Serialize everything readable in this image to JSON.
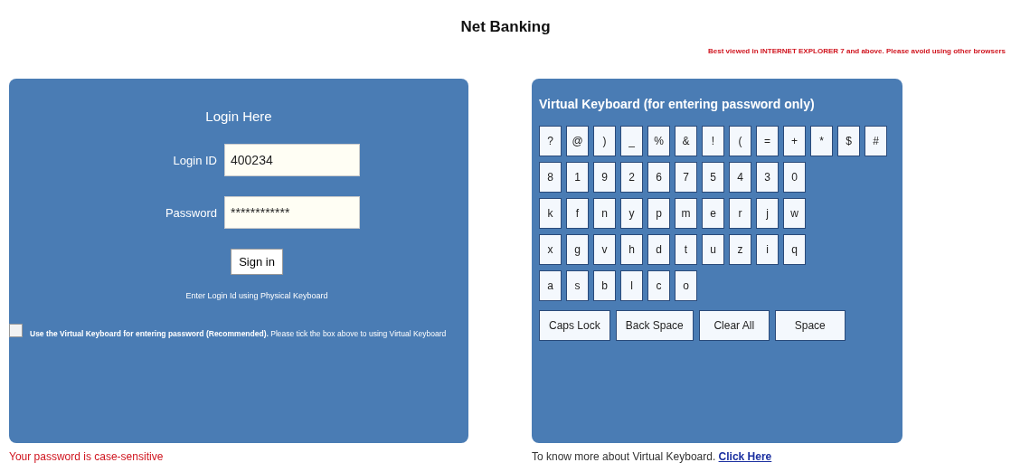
{
  "title": "Net Banking",
  "browser_notice": "Best viewed in INTERNET EXPLORER 7 and above. Please avoid using other browsers",
  "login": {
    "heading": "Login Here",
    "fields": [
      {
        "label": "Login ID",
        "value": "400234"
      },
      {
        "label": "Password",
        "value": "************"
      }
    ],
    "sign_in": "Sign in",
    "hint": "Enter Login Id using Physical Keyboard",
    "virtual_keyboard_option": {
      "checked": false,
      "label": "Use the Virtual Keyboard for entering password (Recommended).",
      "note": "Please tick the box above to using Virtual Keyboard"
    }
  },
  "case_note": "Your password is case-sensitive",
  "keyboard": {
    "heading": "Virtual Keyboard (for entering password only)",
    "rows": [
      [
        "?",
        "@",
        ")",
        "_",
        "%",
        "&",
        "!",
        "(",
        "=",
        "+",
        "*",
        "$",
        "#"
      ],
      [
        "8",
        "1",
        "9",
        "2",
        "6",
        "7",
        "5",
        "4",
        "3",
        "0"
      ],
      [
        "k",
        "f",
        "n",
        "y",
        "p",
        "m",
        "e",
        "r",
        "j",
        "w"
      ],
      [
        "x",
        "g",
        "v",
        "h",
        "d",
        "t",
        "u",
        "z",
        "i",
        "q"
      ],
      [
        "a",
        "s",
        "b",
        "l",
        "c",
        "o"
      ]
    ],
    "actions": [
      "Caps Lock",
      "Back Space",
      "Clear All",
      "Space"
    ]
  },
  "more_info": {
    "text": "To know more about Virtual Keyboard.",
    "link": "Click Here"
  }
}
